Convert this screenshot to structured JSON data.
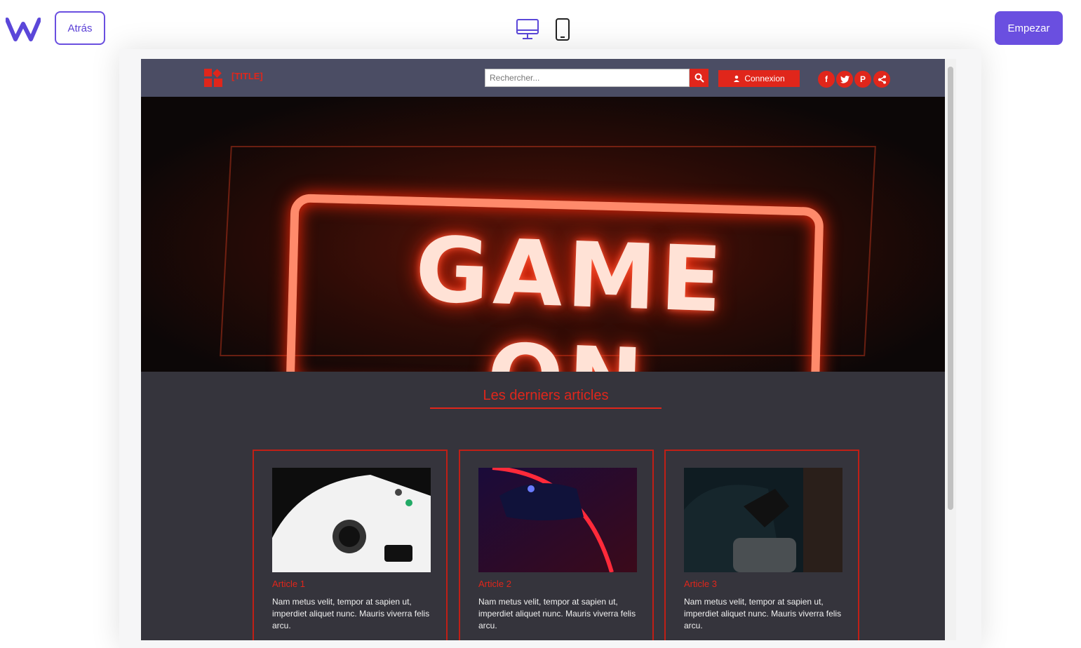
{
  "builder": {
    "back_label": "Atrás",
    "start_label": "Empezar",
    "accent": "#6a4fe0"
  },
  "site": {
    "title": "[TITLE]",
    "search_placeholder": "Rechercher...",
    "login_label": "Connexion",
    "accent": "#e0261b",
    "header_bg": "#4b4d64",
    "social": [
      "facebook-icon",
      "twitter-icon",
      "pinterest-icon",
      "share-icon"
    ]
  },
  "hero": {
    "text": "GAME ON"
  },
  "section": {
    "title": "Les derniers articles"
  },
  "articles": [
    {
      "title": "Article 1",
      "text": "Nam metus velit, tempor at sapien ut, imperdiet aliquet nunc. Mauris viverra felis arcu."
    },
    {
      "title": "Article 2",
      "text": "Nam metus velit, tempor at sapien ut, imperdiet aliquet nunc. Mauris viverra felis arcu."
    },
    {
      "title": "Article 3",
      "text": "Nam metus velit, tempor at sapien ut, imperdiet aliquet nunc. Mauris viverra felis arcu."
    }
  ]
}
